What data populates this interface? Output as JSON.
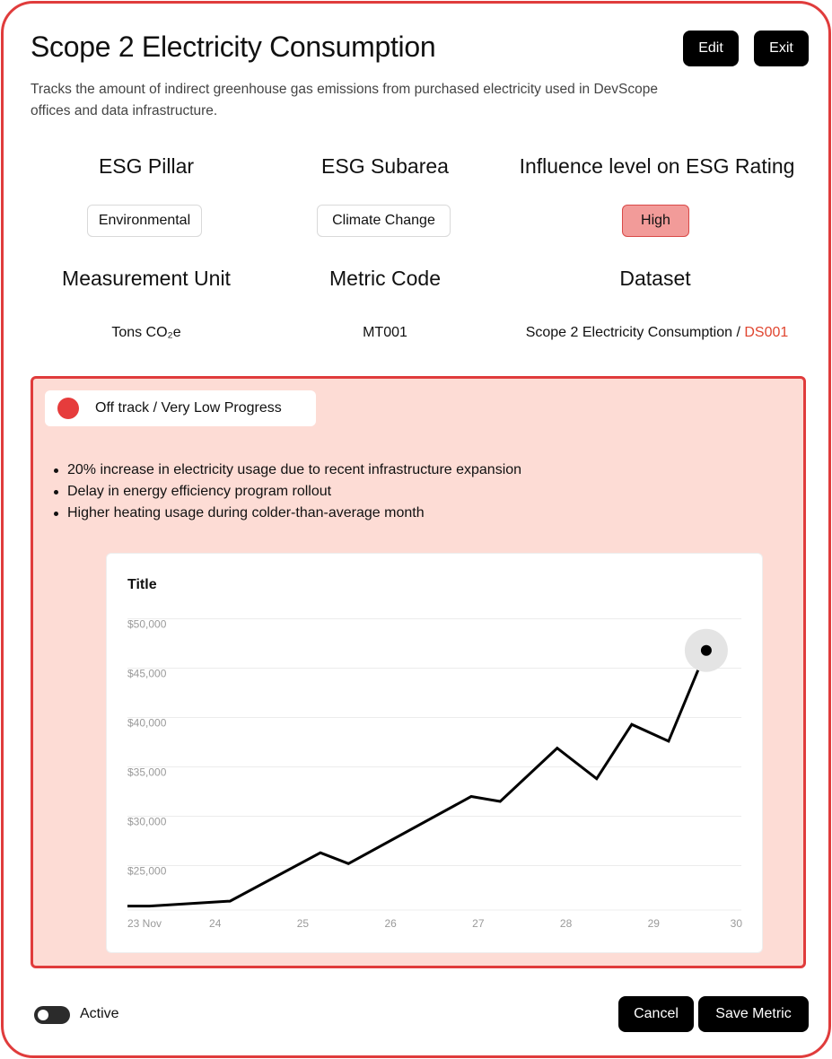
{
  "header": {
    "title": "Scope 2 Electricity Consumption",
    "edit_label": "Edit",
    "exit_label": "Exit",
    "description": "Tracks the amount of indirect greenhouse gas emissions from purchased electricity used in DevScope offices and data infrastructure."
  },
  "attributes": {
    "esg_pillar": {
      "label": "ESG Pillar",
      "value": "Environmental"
    },
    "esg_subarea": {
      "label": "ESG Subarea",
      "value": "Climate Change"
    },
    "influence": {
      "label": "Influence level on ESG Rating",
      "value": "High"
    },
    "unit": {
      "label": "Measurement Unit",
      "value": "Tons CO₂e"
    },
    "metric_code": {
      "label": "Metric Code",
      "value": "MT001"
    },
    "dataset": {
      "label": "Dataset",
      "name": "Scope 2 Electricity Consumption / ",
      "code": "DS001"
    }
  },
  "status": {
    "label": "Off track / Very Low Progress",
    "color": "#e63c3c",
    "panel_bg": "#fddcd5",
    "notes": [
      "20% increase in electricity usage due to recent infrastructure expansion",
      "Delay in energy efficiency program rollout",
      "Higher heating usage during colder-than-average month"
    ]
  },
  "chart_data": {
    "type": "line",
    "title": "Title",
    "xlabel": "",
    "ylabel": "",
    "x_ticks": [
      "23 Nov",
      "24",
      "25",
      "26",
      "27",
      "28",
      "29",
      "30"
    ],
    "y_ticks": [
      "$25,000",
      "$30,000",
      "$35,000",
      "$40,000",
      "$45,000",
      "$50,000"
    ],
    "xlim": [
      23,
      30
    ],
    "ylim": [
      20500,
      50500
    ],
    "grid": true,
    "series": [
      {
        "values": [
          [
            23.0,
            20900
          ],
          [
            23.25,
            20900
          ],
          [
            24.17,
            21400
          ],
          [
            25.2,
            26300
          ],
          [
            25.52,
            25200
          ],
          [
            26.92,
            32000
          ],
          [
            27.25,
            31500
          ],
          [
            27.9,
            36900
          ],
          [
            28.35,
            33800
          ],
          [
            28.75,
            39300
          ],
          [
            29.17,
            37600
          ],
          [
            29.6,
            46800
          ]
        ]
      }
    ],
    "highlight_index": 11
  },
  "footer": {
    "active_label": "Active",
    "active": true,
    "cancel_label": "Cancel",
    "save_label": "Save Metric"
  }
}
